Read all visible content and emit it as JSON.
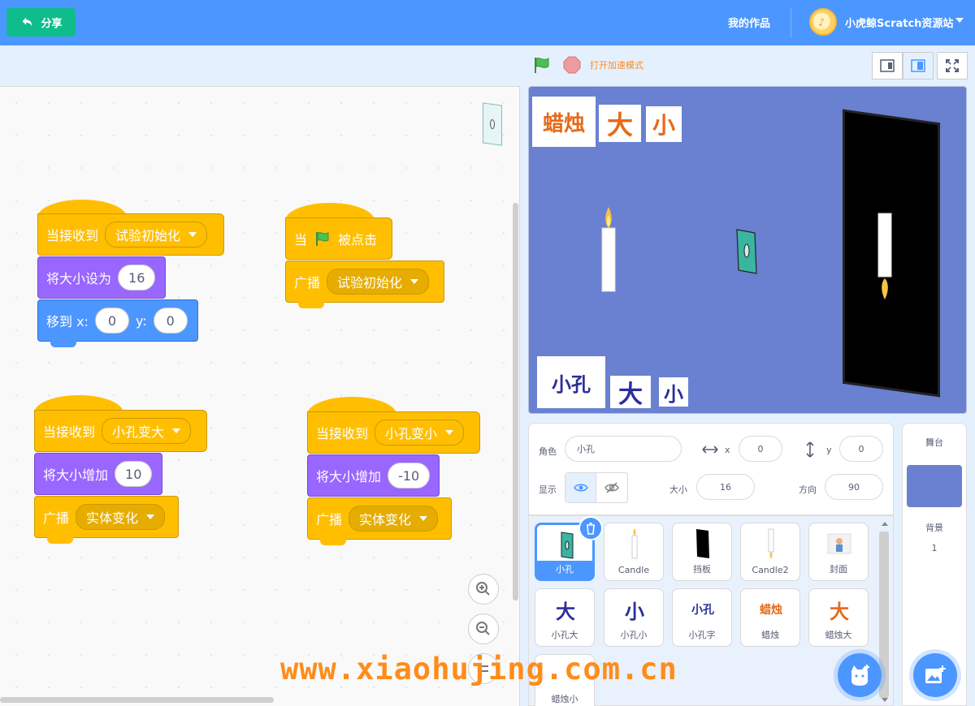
{
  "topbar": {
    "share_label": "分享",
    "my_works": "我的作品",
    "site_name": "小虎鲸Scratch资源站"
  },
  "controls": {
    "turbo_label": "打开加速模式"
  },
  "scripts": {
    "s1": {
      "hat": "当接收到",
      "msg": "试验初始化",
      "size_label": "将大小设为",
      "size_value": "16",
      "goto_label": "移到 x:",
      "x": "0",
      "y_label": "y:",
      "y": "0"
    },
    "s2": {
      "hat_when": "当",
      "hat_clicked": "被点击",
      "broadcast": "广播",
      "msg": "试验初始化"
    },
    "s3": {
      "hat": "当接收到",
      "msg": "小孔变大",
      "change_label": "将大小增加",
      "change_value": "10",
      "broadcast": "广播",
      "bmsg": "实体变化"
    },
    "s4": {
      "hat": "当接收到",
      "msg": "小孔变小",
      "change_label": "将大小增加",
      "change_value": "-10",
      "broadcast": "广播",
      "bmsg": "实体变化"
    }
  },
  "stage_words": {
    "candle": "蜡烛",
    "big1": "大",
    "small1": "小",
    "hole": "小孔",
    "big2": "大",
    "small2": "小"
  },
  "sprite_info": {
    "sprite_label": "角色",
    "sprite_name": "小孔",
    "x_label": "x",
    "x_value": "0",
    "y_label": "y",
    "y_value": "0",
    "show_label": "显示",
    "size_label": "大小",
    "size_value": "16",
    "direction_label": "方向",
    "direction_value": "90"
  },
  "sprites": [
    {
      "name": "小孔",
      "selected": true
    },
    {
      "name": "Candle"
    },
    {
      "name": "挡板"
    },
    {
      "name": "Candle2"
    },
    {
      "name": "封面"
    },
    {
      "name": "小孔大"
    },
    {
      "name": "小孔小"
    },
    {
      "name": "小孔字"
    },
    {
      "name": "蜡烛"
    },
    {
      "name": "蜡烛大"
    },
    {
      "name": "蜡烛小"
    }
  ],
  "thumb_text": {
    "t5": "大",
    "t6": "小",
    "t7": "小孔",
    "t8": "蜡烛",
    "t9": "大"
  },
  "stage_pane": {
    "title": "舞台",
    "backdrop_label": "背景",
    "backdrop_count": "1"
  },
  "watermark": "www.xiaohujing.com.cn",
  "colors": {
    "topbar": "#4c97ff",
    "share": "#0fbd8c",
    "events": "#ffbf00",
    "looks": "#9966ff",
    "motion": "#4c97ff",
    "stage_bg": "#6a80d0",
    "watermark": "#ff8c1a"
  }
}
